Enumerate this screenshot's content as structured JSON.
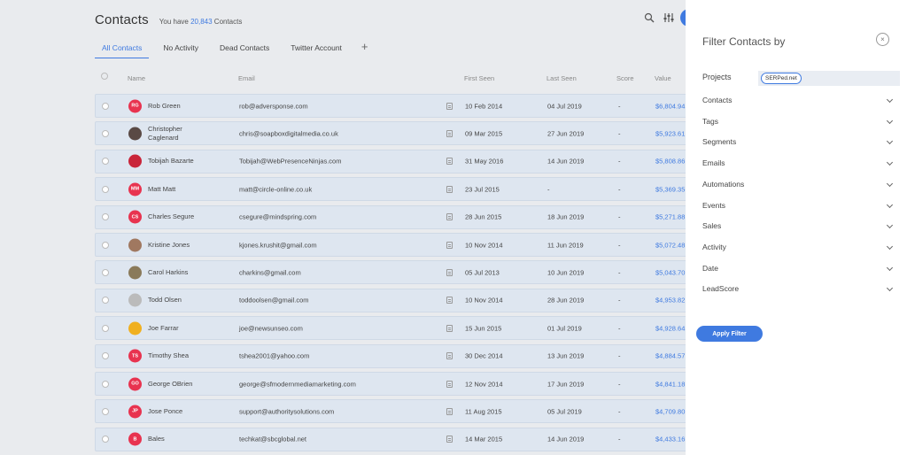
{
  "header": {
    "title": "Contacts",
    "subtitle_prefix": "You have ",
    "count": "20,843",
    "subtitle_suffix": " Contacts"
  },
  "icons": {
    "search": "search-icon",
    "filter": "filter-sliders-icon"
  },
  "tabs": [
    {
      "label": "All Contacts",
      "active": true
    },
    {
      "label": "No Activity",
      "active": false
    },
    {
      "label": "Dead Contacts",
      "active": false
    },
    {
      "label": "Twitter Account",
      "active": false
    }
  ],
  "tab_add": "+",
  "columns": {
    "name": "Name",
    "email": "Email",
    "first_seen": "First Seen",
    "last_seen": "Last Seen",
    "score": "Score",
    "value": "Value"
  },
  "rows": [
    {
      "initials": "RG",
      "avatar_color": "#e8334f",
      "name": "Rob Green",
      "email": "rob@adversponse.com",
      "first": "10 Feb 2014",
      "last": "04 Jul 2019",
      "score": "-",
      "value": "$6,804.94"
    },
    {
      "initials": "",
      "avatar_color": "#5a4a45",
      "name": "Christopher Caglenard",
      "email": "chris@soapboxdigitalmedia.co.uk",
      "first": "09 Mar 2015",
      "last": "27 Jun 2019",
      "score": "-",
      "value": "$5,923.61"
    },
    {
      "initials": "",
      "avatar_color": "#c9253a",
      "name": "Tobijah Bazarte",
      "email": "Tobijah@WebPresenceNinjas.com",
      "first": "31 May 2016",
      "last": "14 Jun 2019",
      "score": "-",
      "value": "$5,808.86"
    },
    {
      "initials": "MM",
      "avatar_color": "#e8334f",
      "name": "Matt Matt",
      "email": "matt@circle-online.co.uk",
      "first": "23 Jul 2015",
      "last": "-",
      "score": "-",
      "value": "$5,369.35"
    },
    {
      "initials": "CS",
      "avatar_color": "#e8334f",
      "name": "Charles Segure",
      "email": "csegure@mindspring.com",
      "first": "28 Jun 2015",
      "last": "18 Jun 2019",
      "score": "-",
      "value": "$5,271.88"
    },
    {
      "initials": "",
      "avatar_color": "#a07860",
      "name": "Kristine Jones",
      "email": "kjones.krushit@gmail.com",
      "first": "10 Nov 2014",
      "last": "11 Jun 2019",
      "score": "-",
      "value": "$5,072.48"
    },
    {
      "initials": "",
      "avatar_color": "#8a7a5a",
      "name": "Carol Harkins",
      "email": "charkins@gmail.com",
      "first": "05 Jul 2013",
      "last": "10 Jun 2019",
      "score": "-",
      "value": "$5,043.70"
    },
    {
      "initials": "",
      "avatar_color": "#bbbbbb",
      "name": "Todd Olsen",
      "email": "toddoolsen@gmail.com",
      "first": "10 Nov 2014",
      "last": "28 Jun 2019",
      "score": "-",
      "value": "$4,953.82"
    },
    {
      "initials": "",
      "avatar_color": "#f0b020",
      "name": "Joe Farrar",
      "email": "joe@newsunseo.com",
      "first": "15 Jun 2015",
      "last": "01 Jul 2019",
      "score": "-",
      "value": "$4,928.64"
    },
    {
      "initials": "TS",
      "avatar_color": "#e8334f",
      "name": "Timothy Shea",
      "email": "tshea2001@yahoo.com",
      "first": "30 Dec 2014",
      "last": "13 Jun 2019",
      "score": "-",
      "value": "$4,884.57"
    },
    {
      "initials": "GO",
      "avatar_color": "#e8334f",
      "name": "George OBrien",
      "email": "george@sfmodernmediamarketing.com",
      "first": "12 Nov 2014",
      "last": "17 Jun 2019",
      "score": "-",
      "value": "$4,841.18"
    },
    {
      "initials": "JP",
      "avatar_color": "#e8334f",
      "name": "Jose Ponce",
      "email": "support@authoritysolutions.com",
      "first": "11 Aug 2015",
      "last": "05 Jul 2019",
      "score": "-",
      "value": "$4,709.80"
    },
    {
      "initials": "B",
      "avatar_color": "#e8334f",
      "name": "Bales",
      "email": "techkat@sbcglobal.net",
      "first": "14 Mar 2015",
      "last": "14 Jun 2019",
      "score": "-",
      "value": "$4,433.16"
    }
  ],
  "panel": {
    "title": "Filter Contacts by",
    "close": "×",
    "projects_label": "Projects",
    "project_chip": "SERPed.net",
    "filters": [
      "Contacts",
      "Tags",
      "Segments",
      "Emails",
      "Automations",
      "Events",
      "Sales",
      "Activity",
      "Date",
      "LeadScore"
    ],
    "apply_label": "Apply Filter"
  },
  "colors": {
    "accent": "#3f7ae0",
    "avatar_red": "#e8334f",
    "row_bg": "#dee6f0"
  }
}
